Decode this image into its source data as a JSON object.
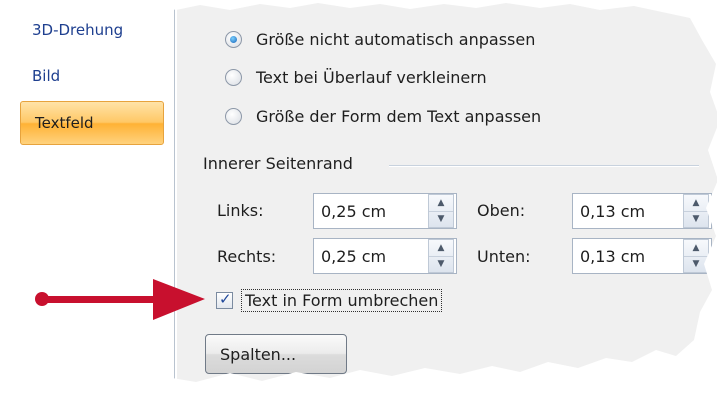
{
  "sidebar": {
    "items": [
      {
        "label": "3D-Drehung"
      },
      {
        "label": "Bild"
      },
      {
        "label": "Textfeld",
        "selected": true
      }
    ]
  },
  "autofit": {
    "options": [
      {
        "label": "Größe nicht automatisch anpassen",
        "checked": true
      },
      {
        "label": "Text bei Überlauf verkleinern",
        "checked": false
      },
      {
        "label": "Größe der Form dem Text anpassen",
        "checked": false
      }
    ]
  },
  "margins": {
    "title": "Innerer Seitenrand",
    "left": {
      "label": "Links:",
      "value": "0,25 cm"
    },
    "right": {
      "label": "Rechts:",
      "value": "0,25 cm"
    },
    "top": {
      "label": "Oben:",
      "value": "0,13 cm"
    },
    "bottom": {
      "label": "Unten:",
      "value": "0,13 cm"
    }
  },
  "wrap": {
    "label": "Text in Form umbrechen",
    "checked": true
  },
  "columns_button": {
    "label": "Spalten..."
  },
  "colors": {
    "arrow": "#c8102e",
    "selected_item": "#ffc866",
    "panel": "#f0f0f0"
  },
  "icons": [
    "arrow-pointer-icon",
    "spin-up-icon",
    "spin-down-icon",
    "check-icon"
  ]
}
